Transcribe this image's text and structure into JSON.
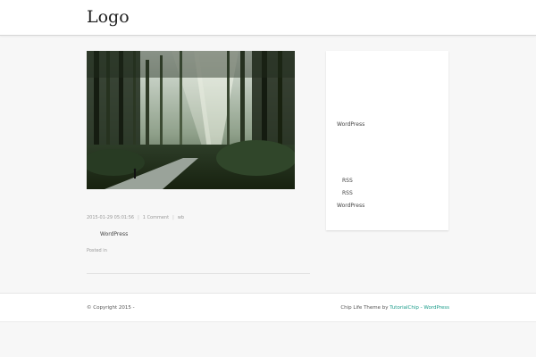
{
  "header": {
    "logo": "Logo"
  },
  "post": {
    "image_alt": "Forest road with sunlight through tall trees",
    "date": "2015-01-29 05:01:56",
    "comments": "1 Comment",
    "author": "wb",
    "separator": "|",
    "body": "WordPress",
    "posted_in": "Posted in"
  },
  "sidebar": {
    "item_1": "WordPress",
    "rss_1": "RSS",
    "rss_2": "RSS",
    "item_2": "WordPress"
  },
  "footer": {
    "copyright": "© Copyright 2015 -",
    "credit_prefix": "Chip Life Theme by",
    "credit_link_1": "TutorialChip",
    "credit_dash": "-",
    "credit_link_2": "WordPress"
  },
  "colors": {
    "link": "#1a9c8a",
    "background": "#f7f7f7"
  }
}
